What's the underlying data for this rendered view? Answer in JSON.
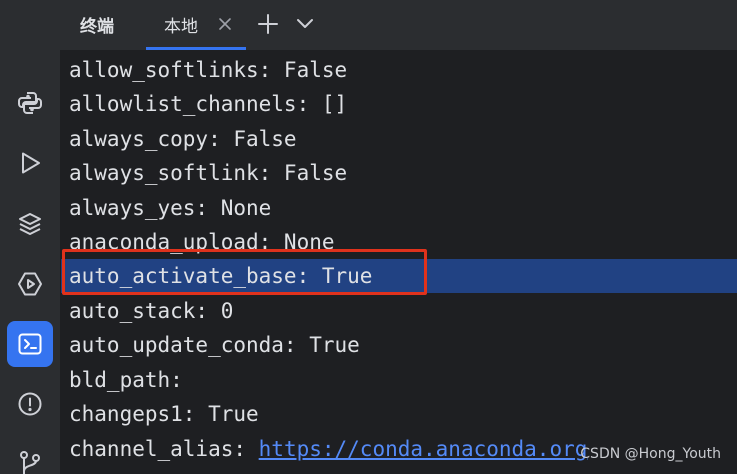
{
  "tool_window": {
    "title": "终端"
  },
  "tabs": [
    {
      "label": "本地",
      "active": true
    }
  ],
  "sidebar": {
    "items": [
      {
        "icon": "python-console-icon",
        "active": false
      },
      {
        "icon": "run-icon",
        "active": false
      },
      {
        "icon": "layers-icon",
        "active": false
      },
      {
        "icon": "services-icon",
        "active": false
      },
      {
        "icon": "terminal-icon",
        "active": true
      },
      {
        "icon": "problems-icon",
        "active": false
      },
      {
        "icon": "git-icon",
        "active": false
      }
    ]
  },
  "terminal": {
    "lines": [
      {
        "text": "allow_softlinks: False"
      },
      {
        "text": "allowlist_channels: []"
      },
      {
        "text": "always_copy: False"
      },
      {
        "text": "always_softlink: False"
      },
      {
        "text": "always_yes: None"
      },
      {
        "text": "anaconda_upload: None"
      },
      {
        "text": "auto_activate_base: True",
        "selected": true
      },
      {
        "text": "auto_stack: 0"
      },
      {
        "text": "auto_update_conda: True"
      },
      {
        "text": "bld_path:"
      },
      {
        "text": "changeps1: True"
      },
      {
        "key": "channel_alias: ",
        "link": "https://conda.anaconda.org"
      }
    ]
  },
  "watermark": "CSDN @Hong_Youth",
  "colors": {
    "accent": "#3574f0",
    "selection": "#214283",
    "annotation_box": "#e0321c",
    "link": "#548af7"
  }
}
